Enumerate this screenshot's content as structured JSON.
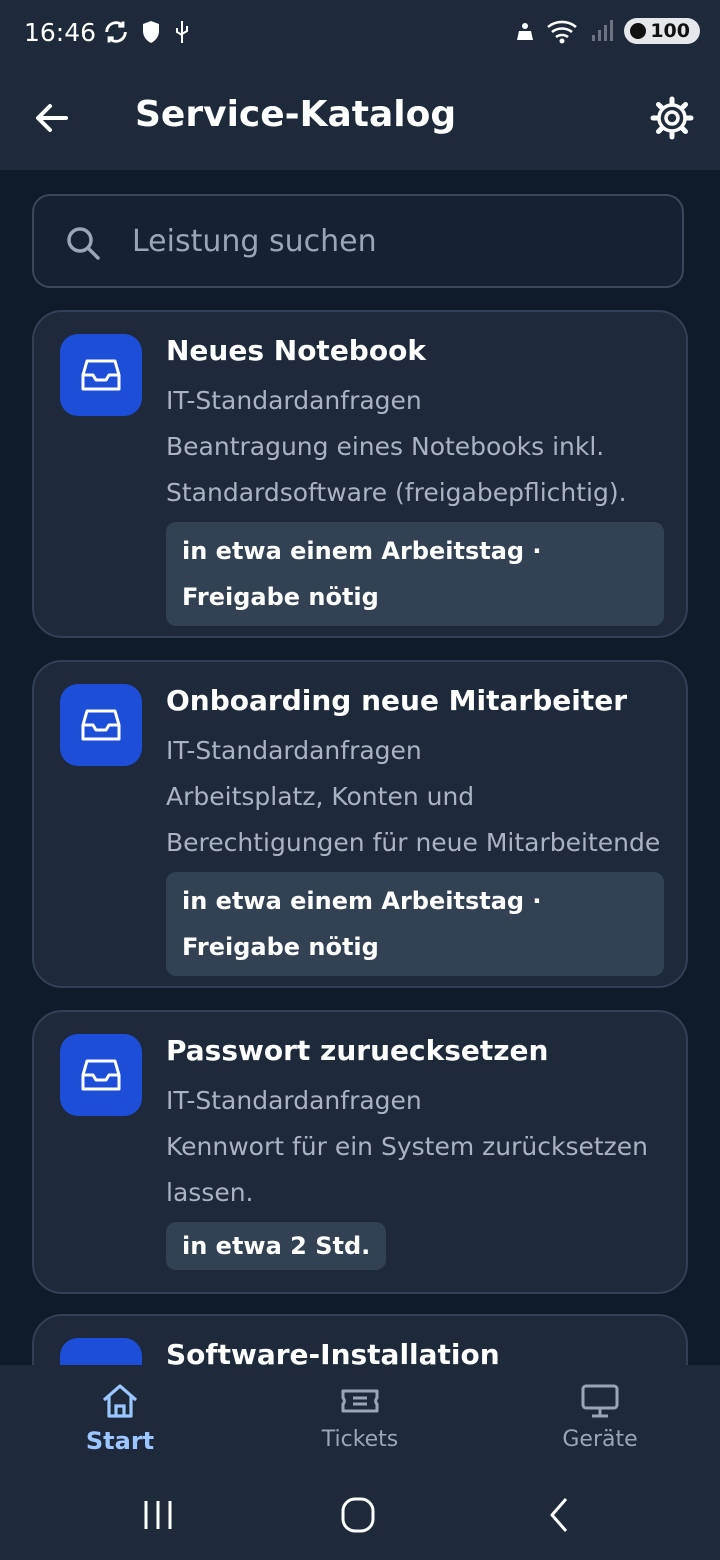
{
  "status_bar": {
    "time": "16:46",
    "battery": "100",
    "icons": [
      "sync-icon",
      "shield-icon",
      "usb-icon",
      "notification-icon",
      "wifi-icon",
      "signal-icon",
      "battery-icon"
    ]
  },
  "app_bar": {
    "title": "Service-Katalog",
    "back_icon": "arrow-left-icon",
    "settings_icon": "gear-icon"
  },
  "search": {
    "placeholder": "Leistung suchen"
  },
  "catalog": [
    {
      "title": "Neues Notebook",
      "category": "IT-Standardanfragen",
      "description": "Beantragung eines Notebooks inkl. Standardsoftware (freigabepflichtig).",
      "badge": "in etwa einem Arbeitstag · Freigabe nötig"
    },
    {
      "title": "Onboarding neue Mitarbeiter",
      "category": "IT-Standardanfragen",
      "description": "Arbeitsplatz, Konten und Berechtigungen für neue Mitarbeitende (freigabepflichtig).",
      "badge": "in etwa einem Arbeitstag · Freigabe nötig"
    },
    {
      "title": "Passwort zuruecksetzen",
      "category": "IT-Standardanfragen",
      "description": "Kennwort für ein System zurücksetzen lassen.",
      "badge": "in etwa 2 Std."
    },
    {
      "title": "Software-Installation"
    }
  ],
  "bottom_nav": [
    {
      "label": "Start",
      "icon": "home-icon",
      "active": true
    },
    {
      "label": "Tickets",
      "icon": "ticket-icon",
      "active": false
    },
    {
      "label": "Geräte",
      "icon": "monitor-icon",
      "active": false
    }
  ],
  "colors": {
    "background": "#0f1a2b",
    "surface": "#1e293b",
    "accent": "#1d4ed8",
    "active_nav": "#9cc6ff"
  }
}
